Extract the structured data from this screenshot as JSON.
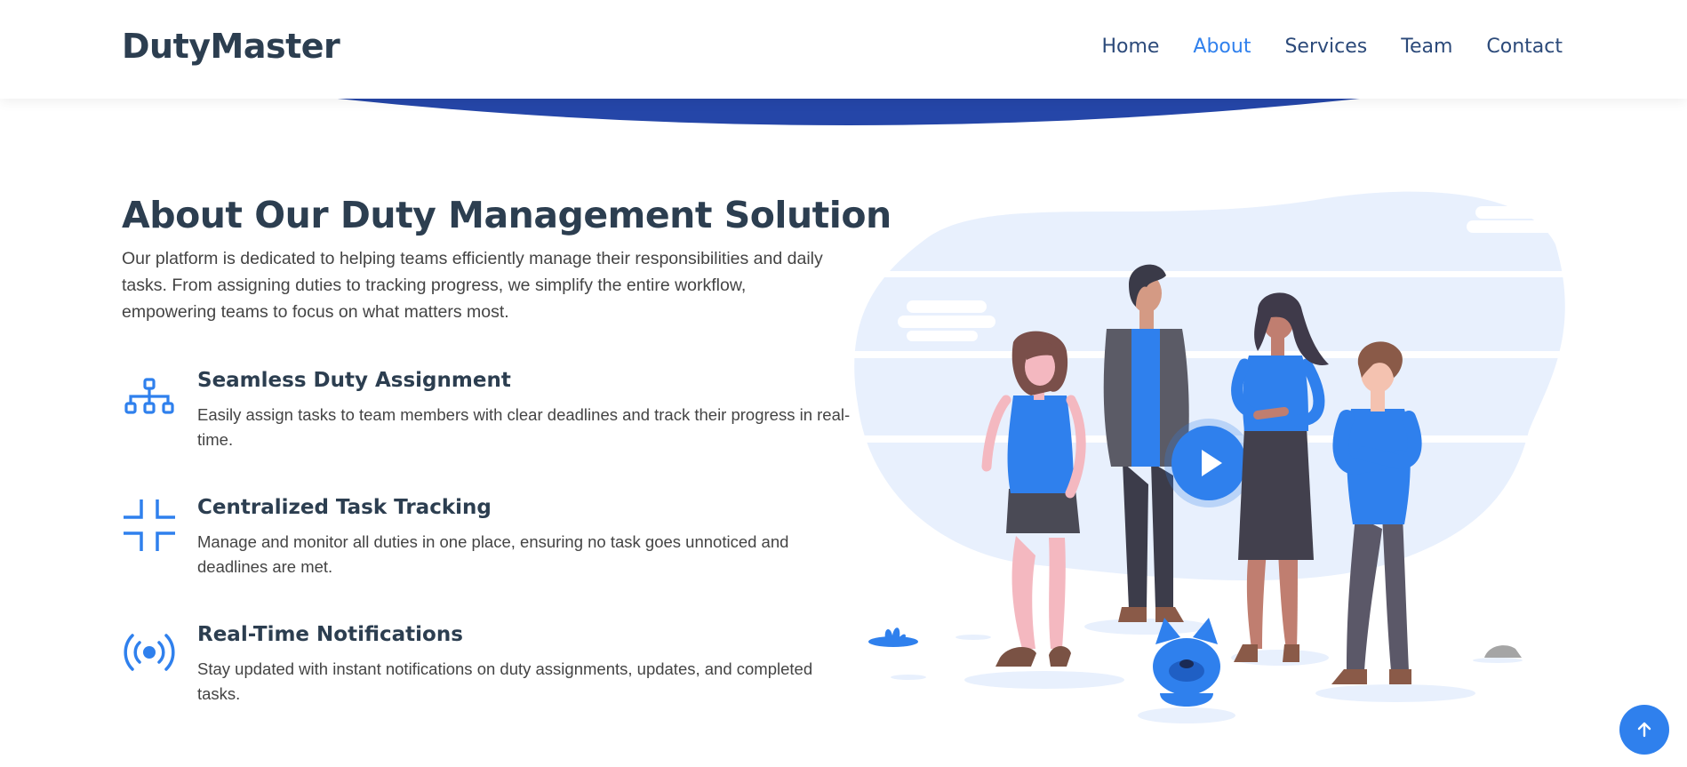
{
  "header": {
    "logo": "DutyMaster",
    "nav": [
      {
        "label": "Home",
        "active": false
      },
      {
        "label": "About",
        "active": true
      },
      {
        "label": "Services",
        "active": false
      },
      {
        "label": "Team",
        "active": false
      },
      {
        "label": "Contact",
        "active": false
      }
    ]
  },
  "about": {
    "title": "About Our Duty Management Solution",
    "description": "Our platform is dedicated to helping teams efficiently manage their responsibilities and daily tasks. From assigning duties to tracking progress, we simplify the entire workflow, empowering teams to focus on what matters most.",
    "features": [
      {
        "icon": "sitemap-icon",
        "title": "Seamless Duty Assignment",
        "description": "Easily assign tasks to team members with clear deadlines and track their progress in real-time."
      },
      {
        "icon": "fullscreen-exit-icon",
        "title": "Centralized Task Tracking",
        "description": "Manage and monitor all duties in one place, ensuring no task goes unnoticed and deadlines are met."
      },
      {
        "icon": "broadcast-icon",
        "title": "Real-Time Notifications",
        "description": "Stay updated with instant notifications on duty assignments, updates, and completed tasks."
      }
    ]
  },
  "illustration": {
    "play_icon": "play-icon"
  },
  "scroll_top": {
    "icon": "arrow-up-icon"
  },
  "colors": {
    "accent": "#2f80ed",
    "heading": "#2c3e50",
    "nav": "#2c4a7a",
    "arc": "#2546a8",
    "blob": "#e8f0fd"
  }
}
